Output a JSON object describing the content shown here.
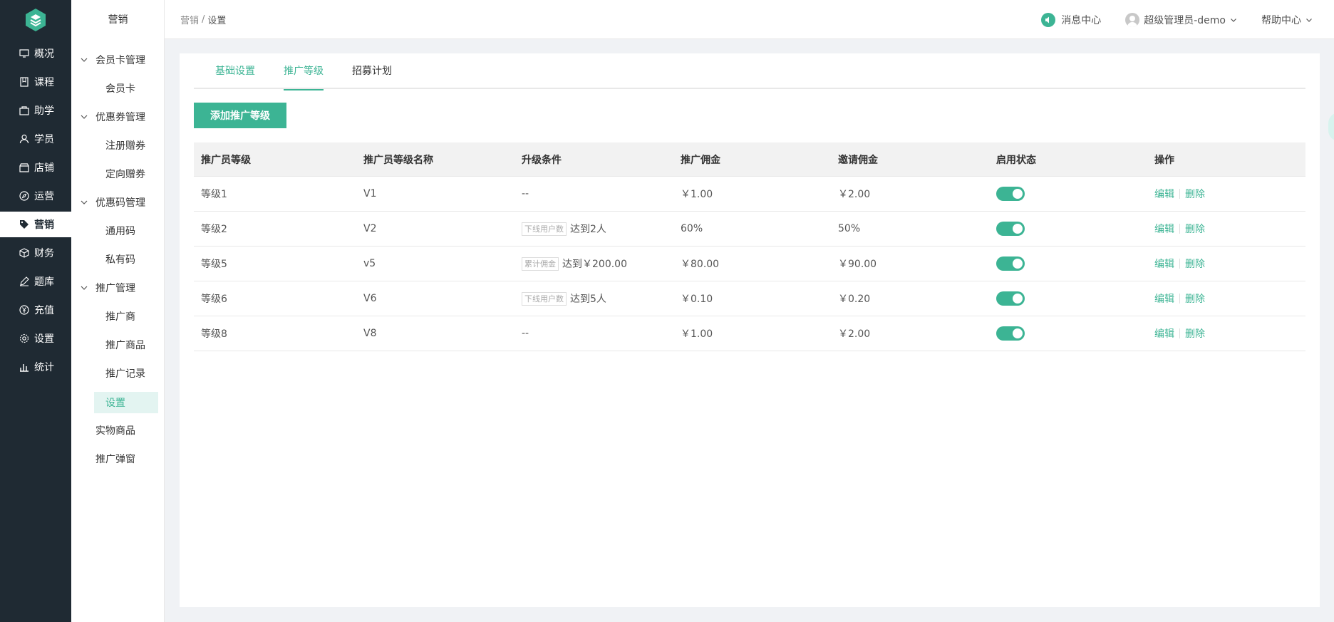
{
  "nav": {
    "items": [
      {
        "label": "概况",
        "icon": "monitor-icon"
      },
      {
        "label": "课程",
        "icon": "book-icon"
      },
      {
        "label": "助学",
        "icon": "bag-icon"
      },
      {
        "label": "学员",
        "icon": "user-icon"
      },
      {
        "label": "店铺",
        "icon": "shop-icon"
      },
      {
        "label": "运营",
        "icon": "compass-icon"
      },
      {
        "label": "营销",
        "icon": "tag-icon"
      },
      {
        "label": "财务",
        "icon": "cube-icon"
      },
      {
        "label": "题库",
        "icon": "pen-icon"
      },
      {
        "label": "充值",
        "icon": "yen-icon"
      },
      {
        "label": "设置",
        "icon": "gear-icon"
      },
      {
        "label": "统计",
        "icon": "bar-chart-icon"
      }
    ],
    "active": "营销"
  },
  "sidebar": {
    "title": "营销",
    "groups": [
      {
        "label": "会员卡管理",
        "items": [
          "会员卡"
        ]
      },
      {
        "label": "优惠券管理",
        "items": [
          "注册赠券",
          "定向赠券"
        ]
      },
      {
        "label": "优惠码管理",
        "items": [
          "通用码",
          "私有码"
        ]
      },
      {
        "label": "推广管理",
        "items": [
          "推广商",
          "推广商品",
          "推广记录",
          "设置"
        ]
      }
    ],
    "extra": [
      "实物商品",
      "推广弹窗"
    ],
    "active_item": "设置"
  },
  "header": {
    "breadcrumb": [
      "营销",
      "设置"
    ],
    "breadcrumb_sep": "/",
    "messages": "消息中心",
    "user": "超级管理员-demo",
    "help": "帮助中心"
  },
  "tabs": [
    "基础设置",
    "推广等级",
    "招募计划"
  ],
  "active_tab": "推广等级",
  "add_button": "添加推广等级",
  "table": {
    "columns": [
      "推广员等级",
      "推广员等级名称",
      "升级条件",
      "推广佣金",
      "邀请佣金",
      "启用状态",
      "操作"
    ],
    "rows": [
      {
        "level": "等级1",
        "name": "V1",
        "cond_tag": "",
        "cond_text": "--",
        "commission": "￥1.00",
        "invite": "￥2.00",
        "enabled": true
      },
      {
        "level": "等级2",
        "name": "V2",
        "cond_tag": "下线用户数",
        "cond_text": "达到2人",
        "commission": "60%",
        "invite": "50%",
        "enabled": true
      },
      {
        "level": "等级5",
        "name": "v5",
        "cond_tag": "累计佣金",
        "cond_text": "达到￥200.00",
        "commission": "￥80.00",
        "invite": "￥90.00",
        "enabled": true
      },
      {
        "level": "等级6",
        "name": "V6",
        "cond_tag": "下线用户数",
        "cond_text": "达到5人",
        "commission": "￥0.10",
        "invite": "￥0.20",
        "enabled": true
      },
      {
        "level": "等级8",
        "name": "V8",
        "cond_tag": "",
        "cond_text": "--",
        "commission": "￥1.00",
        "invite": "￥2.00",
        "enabled": true
      }
    ],
    "ops": {
      "edit": "编辑",
      "delete": "删除"
    }
  },
  "colors": {
    "accent": "#3cb494",
    "nav_bg": "#1f2a33"
  }
}
